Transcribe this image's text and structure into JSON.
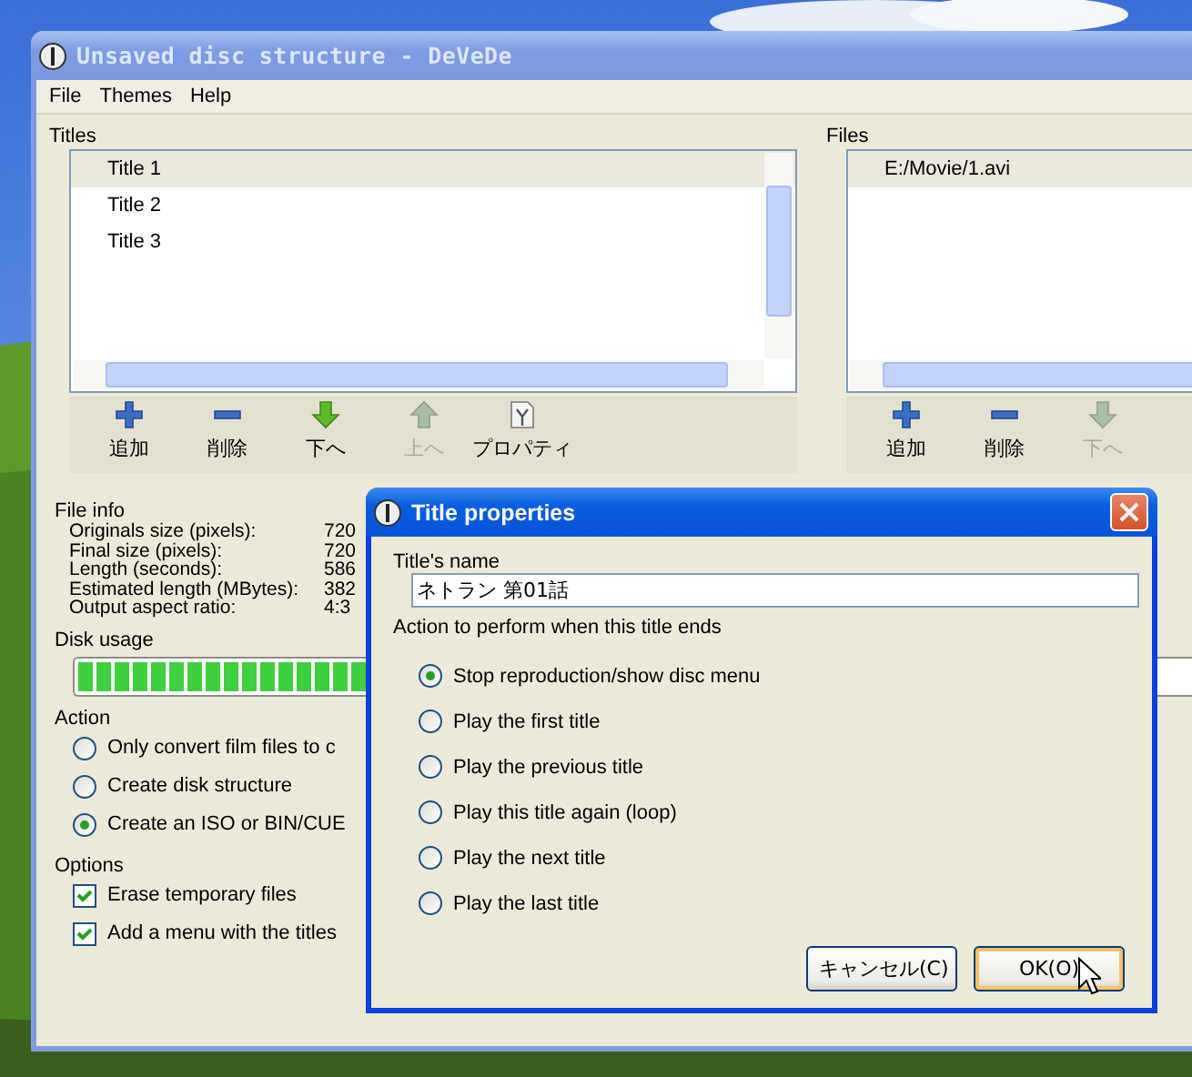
{
  "main_window": {
    "title": "Unsaved disc structure - DeVeDe"
  },
  "menu": [
    "File",
    "Themes",
    "Help"
  ],
  "titles": {
    "label": "Titles",
    "items": [
      {
        "label": "Title 1",
        "selected": true
      },
      {
        "label": "Title 2",
        "selected": false
      },
      {
        "label": "Title 3",
        "selected": false
      }
    ],
    "toolbar": [
      {
        "label": "追加",
        "kind": "add",
        "disabled": false
      },
      {
        "label": "削除",
        "kind": "remove",
        "disabled": false
      },
      {
        "label": "下へ",
        "kind": "down",
        "disabled": false
      },
      {
        "label": "上へ",
        "kind": "up",
        "disabled": true
      },
      {
        "label": "プロパティ",
        "kind": "properties",
        "disabled": false
      }
    ]
  },
  "files": {
    "label": "Files",
    "items": [
      {
        "label": "E:/Movie/1.avi",
        "selected": true
      }
    ],
    "toolbar": [
      {
        "label": "追加",
        "kind": "add",
        "disabled": false
      },
      {
        "label": "削除",
        "kind": "remove",
        "disabled": false
      },
      {
        "label": "下へ",
        "kind": "down",
        "disabled": true
      }
    ]
  },
  "file_info": {
    "label": "File info",
    "rows": [
      {
        "name": "Originals size (pixels):",
        "value": "720"
      },
      {
        "name": "Final size (pixels):",
        "value": "720"
      },
      {
        "name": "Length (seconds):",
        "value": "586"
      },
      {
        "name": "Estimated length (MBytes):",
        "value": "382"
      },
      {
        "name": "Output aspect ratio:",
        "value": "4:3"
      }
    ]
  },
  "disk_usage": {
    "label": "Disk usage",
    "level": 0.4
  },
  "action": {
    "label": "Action",
    "options": [
      {
        "label": "Only convert film files to c",
        "selected": false
      },
      {
        "label": "Create disk structure",
        "selected": false
      },
      {
        "label": "Create an ISO or BIN/CUE",
        "selected": true
      }
    ]
  },
  "options": {
    "label": "Options",
    "items": [
      {
        "label": "Erase temporary files",
        "checked": true
      },
      {
        "label": "Add a menu with the titles",
        "checked": true
      }
    ]
  },
  "dialog": {
    "title": "Title properties",
    "name_label": "Title's name",
    "name_value": "ネトラン 第01話",
    "action_label": "Action to perform when this title ends",
    "options": [
      {
        "label": "Stop reproduction/show disc menu",
        "selected": true
      },
      {
        "label": "Play the first title",
        "selected": false
      },
      {
        "label": "Play the previous title",
        "selected": false
      },
      {
        "label": "Play this title again (loop)",
        "selected": false
      },
      {
        "label": "Play the next title",
        "selected": false
      },
      {
        "label": "Play the last title",
        "selected": false
      }
    ],
    "buttons": [
      {
        "label": "キャンセル(C)",
        "focused": false
      },
      {
        "label": "OK(O)",
        "focused": true
      }
    ]
  }
}
